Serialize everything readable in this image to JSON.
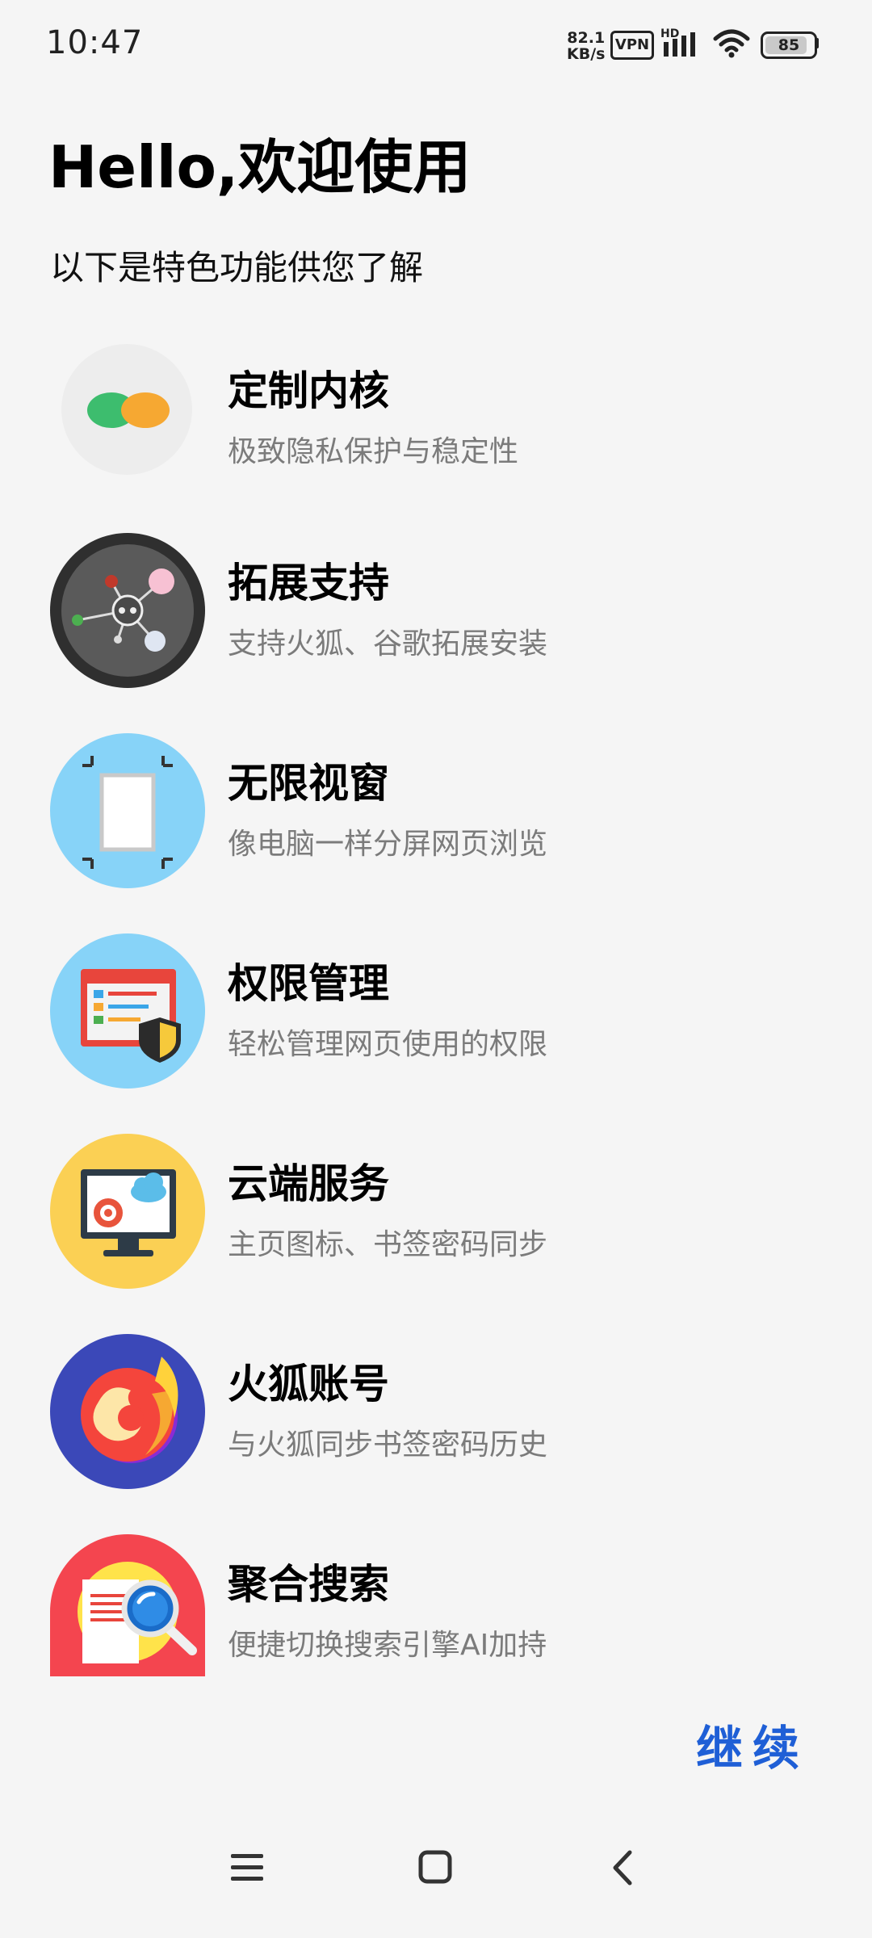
{
  "status_bar": {
    "time": "10:47",
    "speed_value": "82.1",
    "speed_unit": "KB/s",
    "vpn": "VPN",
    "hd": "HD",
    "battery": "85",
    "icons": [
      "signal-icon",
      "wifi-icon",
      "battery-icon"
    ]
  },
  "header": {
    "title": "Hello,欢迎使用",
    "subtitle": "以下是特色功能供您了解"
  },
  "features": [
    {
      "name": "定制内核",
      "desc": "极致隐私保护与稳定性",
      "icon": "custom-kernel-icon",
      "bg": "#ededed"
    },
    {
      "name": "拓展支持",
      "desc": "支持火狐、谷歌拓展安装",
      "icon": "extension-icon",
      "bg": "#2f2f2f"
    },
    {
      "name": "无限视窗",
      "desc": "像电脑一样分屏网页浏览",
      "icon": "window-icon",
      "bg": "#87d3f8"
    },
    {
      "name": "权限管理",
      "desc": "轻松管理网页使用的权限",
      "icon": "permission-shield-icon",
      "bg": "#87d3f8"
    },
    {
      "name": "云端服务",
      "desc": "主页图标、书签密码同步",
      "icon": "cloud-monitor-icon",
      "bg": "#fbd054"
    },
    {
      "name": "火狐账号",
      "desc": "与火狐同步书签密码历史",
      "icon": "firefox-icon",
      "bg": "#3b48b8"
    },
    {
      "name": "聚合搜索",
      "desc": "便捷切换搜索引擎AI加持",
      "icon": "search-document-icon",
      "bg": "#f4454f"
    }
  ],
  "continue_label": "继续",
  "nav": {
    "icons": [
      "menu-icon",
      "home-icon",
      "back-icon"
    ]
  },
  "colors": {
    "accent": "#1f5fd6",
    "background": "#f5f5f5",
    "muted_text": "#7b7b7b"
  }
}
